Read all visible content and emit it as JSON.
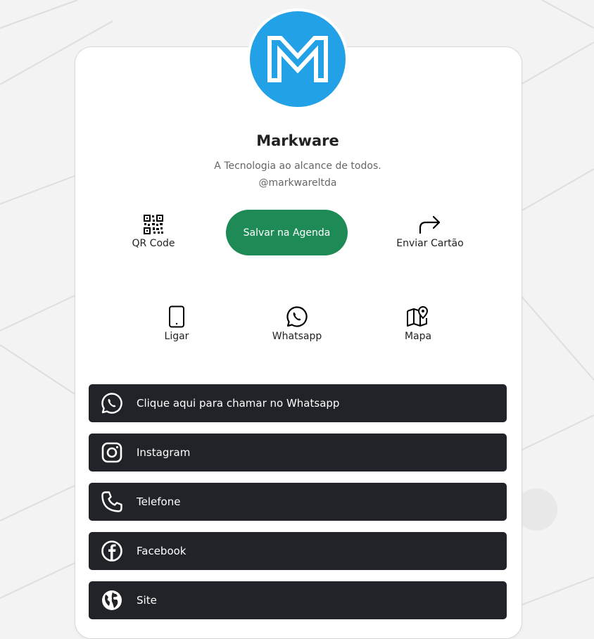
{
  "profile": {
    "name": "Markware",
    "tagline": "A Tecnologia ao alcance de todos.",
    "handle": "@markwareltda",
    "logo_icon": "markware-m-logo"
  },
  "actions": {
    "qr_label": "QR Code",
    "save_label": "Salvar na Agenda",
    "share_label": "Enviar Cartão",
    "call_label": "Ligar",
    "whatsapp_label": "Whatsapp",
    "map_label": "Mapa"
  },
  "links": [
    {
      "label": "Clique aqui para chamar no Whatsapp",
      "icon": "whatsapp-icon"
    },
    {
      "label": "Instagram",
      "icon": "instagram-icon"
    },
    {
      "label": "Telefone",
      "icon": "phone-icon"
    },
    {
      "label": "Facebook",
      "icon": "facebook-icon"
    },
    {
      "label": "Site",
      "icon": "globe-icon"
    }
  ],
  "colors": {
    "logo_bg": "#22a1e6",
    "save_button": "#1e8a55",
    "link_button": "#212328",
    "background": "#f3f3f3"
  }
}
